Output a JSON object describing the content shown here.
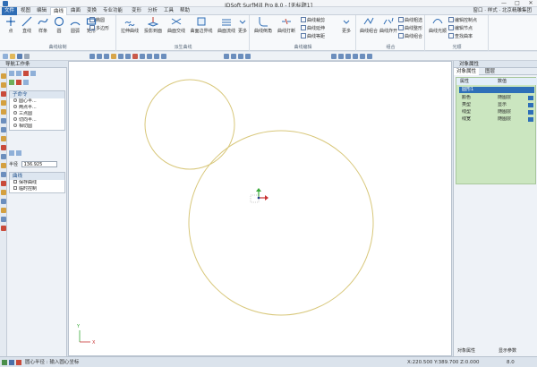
{
  "window": {
    "title": "JDSoft SurfMill Pro 8.0 - [无标题1]",
    "minimize": "—",
    "maximize": "□",
    "close": "✕"
  },
  "tabs": {
    "file": "文件",
    "items": [
      "视图",
      "编辑",
      "曲线",
      "曲面",
      "变换",
      "专业功能",
      "变形",
      "分析",
      "工具",
      "帮助"
    ],
    "active": "曲线",
    "right_info": "窗口 · 样式 · 北京精雕集团"
  },
  "ribbon": {
    "groups": [
      {
        "label": "曲线绘制",
        "buttons": [
          "点",
          "直线",
          "样条",
          "圆",
          "圆弧",
          "矩形"
        ],
        "extra": [
          "椭圆",
          "多边形"
        ]
      },
      {
        "label": "派生曲线",
        "buttons": [
          "拉伸曲线",
          "投影到面",
          "曲面交线",
          "曲面边界线",
          "曲面流线",
          "更多"
        ]
      },
      {
        "label": "曲线编辑",
        "buttons": [
          "曲线倒角",
          "曲线打断",
          "更多"
        ],
        "small": [
          "曲线裁剪",
          "曲线延伸",
          "曲线等距"
        ]
      },
      {
        "label": "组合",
        "buttons": [
          "曲线组合",
          "曲线炸开"
        ],
        "small": [
          "曲线粗选",
          "曲线整形",
          "曲线组合"
        ]
      },
      {
        "label": "光顺",
        "buttons": [
          "曲线光顺"
        ],
        "small": [
          "编辑控制点",
          "编辑节点",
          "查找曲率"
        ]
      }
    ]
  },
  "left_panel": {
    "title": "导航工作条",
    "section1": {
      "header": "子命令",
      "items": [
        "圆心半...",
        "两点半...",
        "三点圆",
        "切向半...",
        "相切圆"
      ]
    },
    "param_label": "半径",
    "param_value": "136.925",
    "section2": {
      "header": "曲线",
      "items": [
        "保存曲线",
        "临时控制"
      ]
    }
  },
  "right_panel": {
    "title": "对象属性",
    "tabs": [
      "对象属性",
      "图层"
    ],
    "table_head": [
      "属性",
      "数值"
    ],
    "group": "圆形1",
    "rows": [
      {
        "k": "颜色",
        "v": "随图层"
      },
      {
        "k": "类型",
        "v": "显示"
      },
      {
        "k": "线型",
        "v": "随图层"
      },
      {
        "k": "线宽",
        "v": "随图层"
      }
    ],
    "footer": [
      "对象属性",
      "显示参数"
    ]
  },
  "canvas": {
    "circles": [
      {
        "name": "small-circle",
        "center": [
          211,
          138
        ],
        "r": 50
      },
      {
        "name": "large-circle",
        "center": [
          313,
          248
        ],
        "r": 103
      }
    ],
    "origin": {
      "x_label": "X",
      "y_label": "Y"
    }
  },
  "status": {
    "left": "圆心半径 : 输入圆心坐标",
    "coords": "X:220.500  Y:389.700  Z:0.000",
    "right": "8.0"
  }
}
